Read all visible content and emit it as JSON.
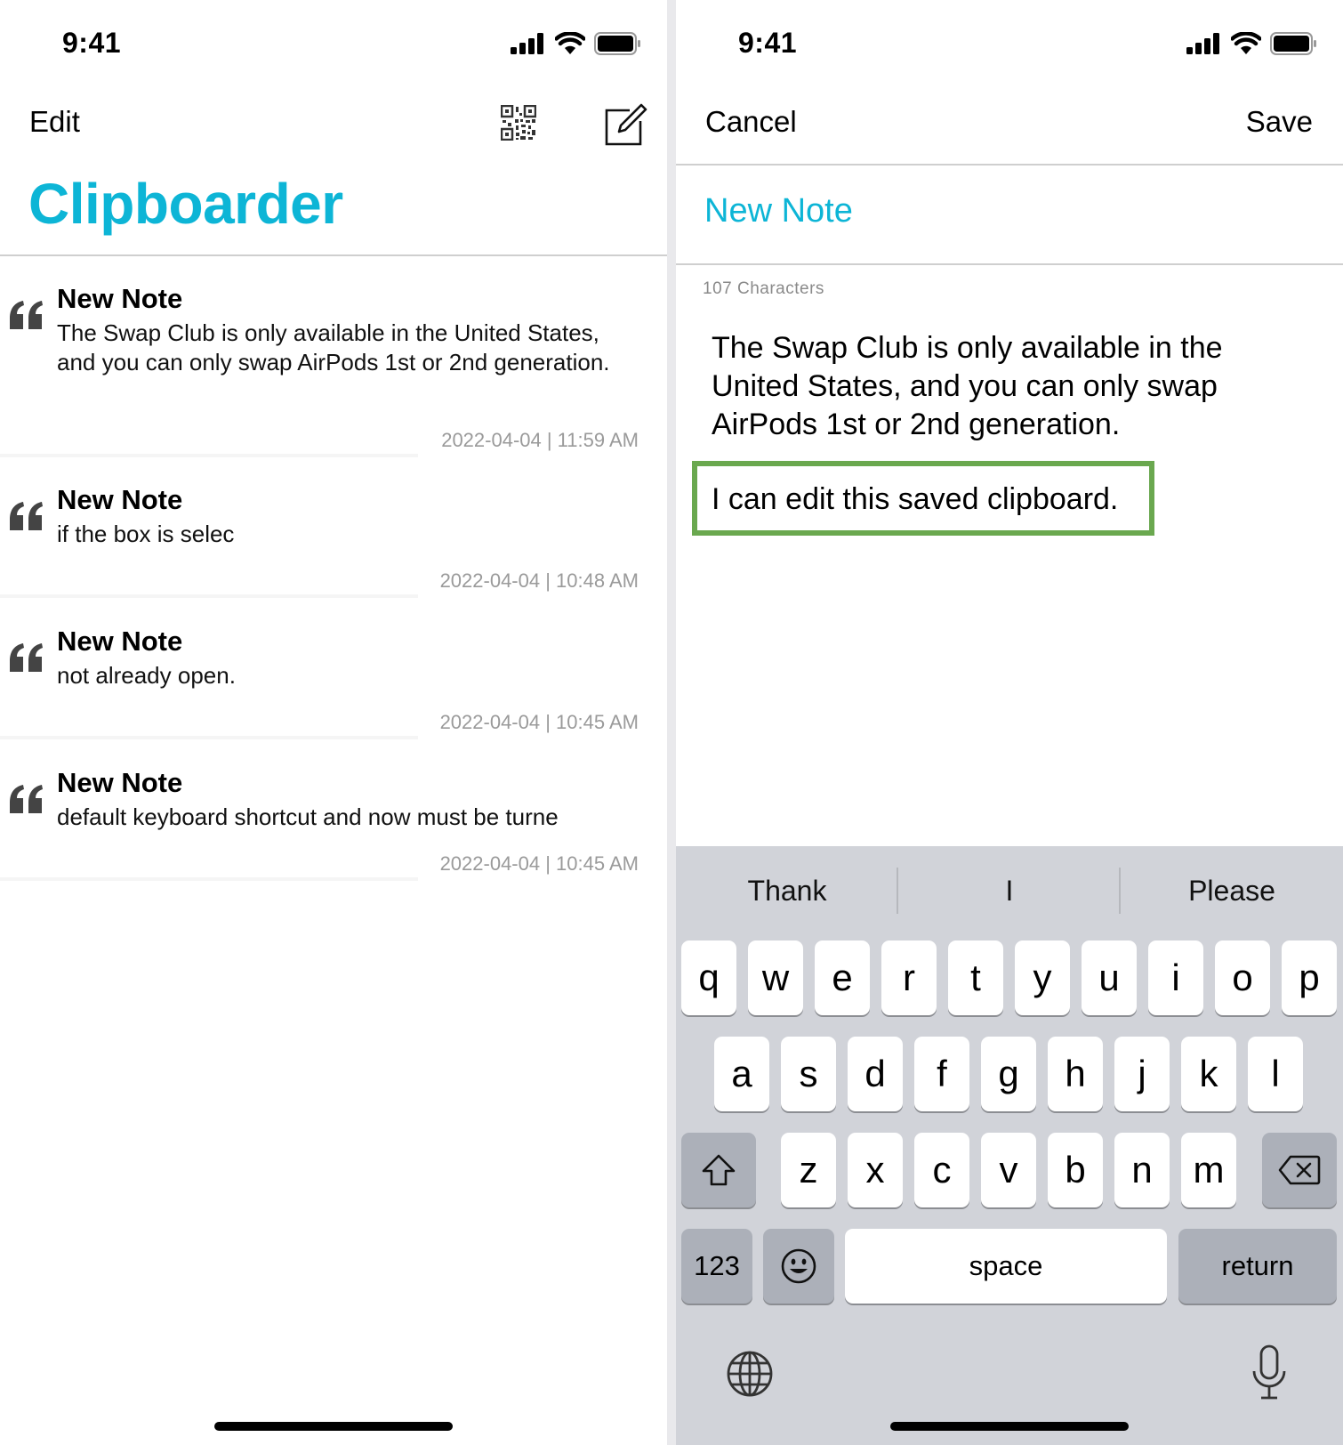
{
  "left": {
    "status": {
      "time": "9:41"
    },
    "nav": {
      "edit_label": "Edit"
    },
    "title": "Clipboarder",
    "notes": [
      {
        "title": "New Note",
        "body": "The Swap Club is only available in the United States, and you can only swap AirPods 1st or 2nd generation.",
        "date": "2022-04-04 | 11:59 AM"
      },
      {
        "title": "New Note",
        "body": "if the box is selec",
        "date": "2022-04-04 | 10:48 AM"
      },
      {
        "title": "New Note",
        "body": "not already open.",
        "date": "2022-04-04 | 10:45 AM"
      },
      {
        "title": "New Note",
        "body": "default keyboard shortcut and now must be turne",
        "date": "2022-04-04 | 10:45 AM"
      }
    ]
  },
  "right": {
    "status": {
      "time": "9:41"
    },
    "nav": {
      "cancel_label": "Cancel",
      "save_label": "Save"
    },
    "note_title": "New Note",
    "char_count": "107 Characters",
    "body_text": "The Swap Club is only available in the United States, and you can only swap AirPods 1st or 2nd generation.",
    "edited_line": "I can edit this saved clipboard.",
    "highlight_color": "#6aa84f",
    "keyboard": {
      "suggestions": [
        "Thank",
        "I",
        "Please"
      ],
      "row1": [
        "q",
        "w",
        "e",
        "r",
        "t",
        "y",
        "u",
        "i",
        "o",
        "p"
      ],
      "row2": [
        "a",
        "s",
        "d",
        "f",
        "g",
        "h",
        "j",
        "k",
        "l"
      ],
      "row3": [
        "z",
        "x",
        "c",
        "v",
        "b",
        "n",
        "m"
      ],
      "numbers_label": "123",
      "space_label": "space",
      "return_label": "return"
    }
  },
  "colors": {
    "accent": "#0db5d6"
  }
}
